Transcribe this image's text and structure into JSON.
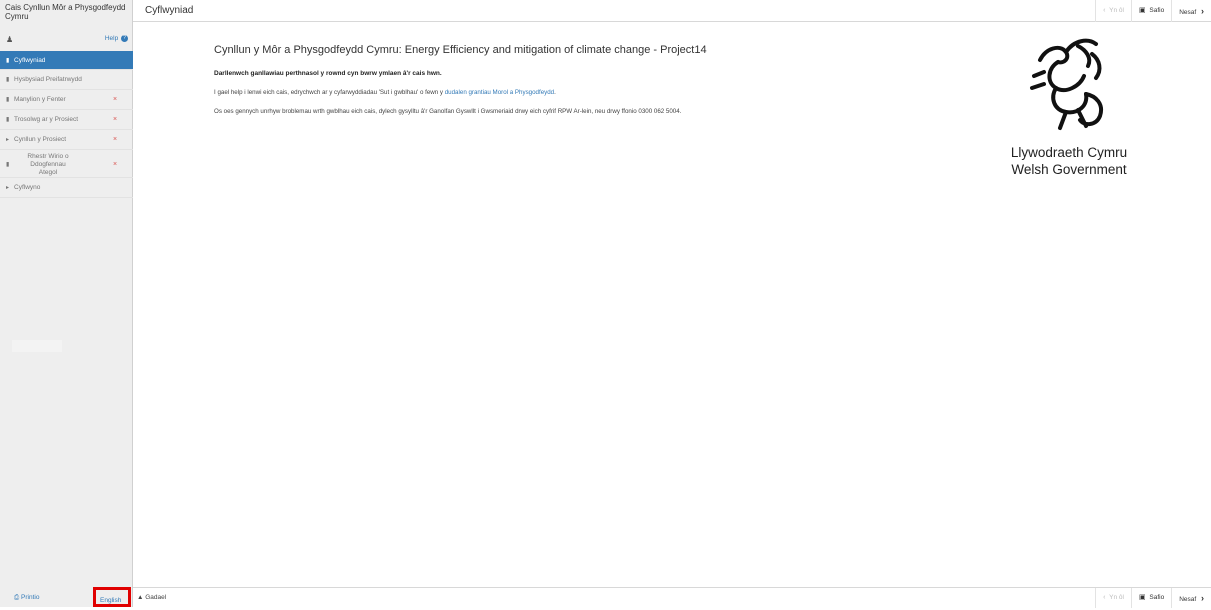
{
  "sidebar": {
    "app_title": "Cais Cynllun Môr a Physgodfeydd Cymru",
    "user_icon": "user-icon",
    "help_label": "Help",
    "items": [
      {
        "label": "Cyflwyniad",
        "icon": "document-icon",
        "active": true,
        "error": false
      },
      {
        "label": "Hysbysiad Preifatrwydd",
        "icon": "document-icon",
        "active": false,
        "error": false
      },
      {
        "label": "Manylion y Fenter",
        "icon": "document-icon",
        "active": false,
        "error": true
      },
      {
        "label": "Trosolwg ar y Prosiect",
        "icon": "document-icon",
        "active": false,
        "error": true
      },
      {
        "label": "Cynllun y Prosiect",
        "icon": "caret-right-icon",
        "active": false,
        "error": true
      },
      {
        "label": "Rhestr Wirio o Ddogfennau Ategol",
        "icon": "document-icon",
        "active": false,
        "error": true
      },
      {
        "label": "Cyflwyno",
        "icon": "caret-right-icon",
        "active": false,
        "error": false
      }
    ],
    "error_mark": "×",
    "print_label": "Printio",
    "language_label": "English"
  },
  "topbar": {
    "page_heading": "Cyflwyniad",
    "prev_label": "Yn ôl",
    "save_label": "Safio",
    "next_label": "Nesaf"
  },
  "main": {
    "title": "Cynllun y Môr a Physgodfeydd Cymru: Energy Efficiency and mitigation of climate change - Project14",
    "intro_bold": "Darllenwch ganllawiau perthnasol y rownd cyn bwrw ymlaen â'r cais hwn.",
    "help_text_prefix": "I gael help i lenwi eich cais, edrychwch ar y cyfarwyddiadau 'Sut i gwblhau' o fewn y ",
    "help_link": "dudalen grantiau Morol a Physgodfeydd",
    "help_text_suffix": ".",
    "contact_text": "Os oes gennych unrhyw broblemau wrth gwblhau eich cais, dylech gysylltu â'r Ganolfan Gyswllt i Gwsmeriaid drwy eich cyfrif RPW Ar-lein, neu drwy ffonio 0300 062 5004."
  },
  "logo": {
    "line1": "Llywodraeth Cymru",
    "line2": "Welsh Government"
  },
  "bottombar": {
    "exit_label": "Gadael",
    "prev_label": "Yn ôl",
    "save_label": "Safio",
    "next_label": "Nesaf"
  }
}
